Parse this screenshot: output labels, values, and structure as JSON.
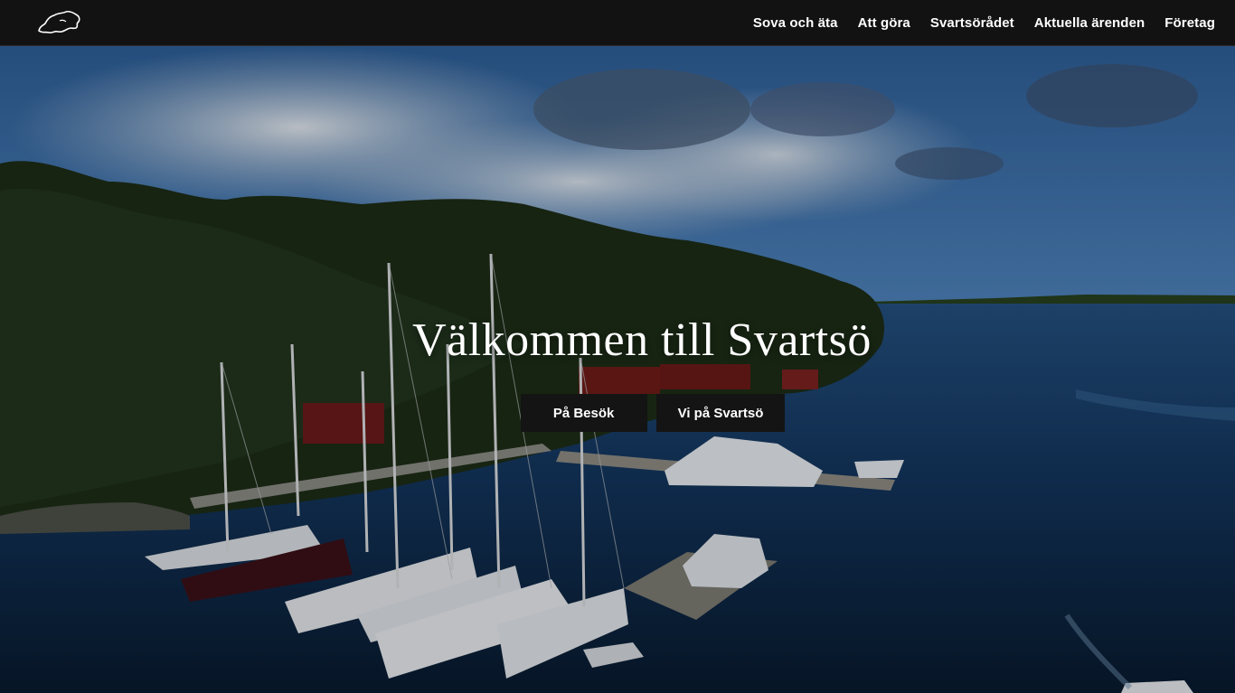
{
  "header": {
    "logo_icon": "island-outline-logo",
    "nav": [
      {
        "label": "Sova och äta"
      },
      {
        "label": "Att göra"
      },
      {
        "label": "Svartsörådet"
      },
      {
        "label": "Aktuella ärenden"
      },
      {
        "label": "Företag"
      }
    ]
  },
  "hero": {
    "title": "Välkommen till Svartsö",
    "buttons": [
      {
        "label": "På Besök"
      },
      {
        "label": "Vi på Svartsö"
      }
    ]
  },
  "colors": {
    "header_bg": "#121212",
    "button_bg": "#141414",
    "text": "#ffffff",
    "sky": "#3f6ea3",
    "water": "#102a46",
    "forest": "#1b2a17"
  }
}
